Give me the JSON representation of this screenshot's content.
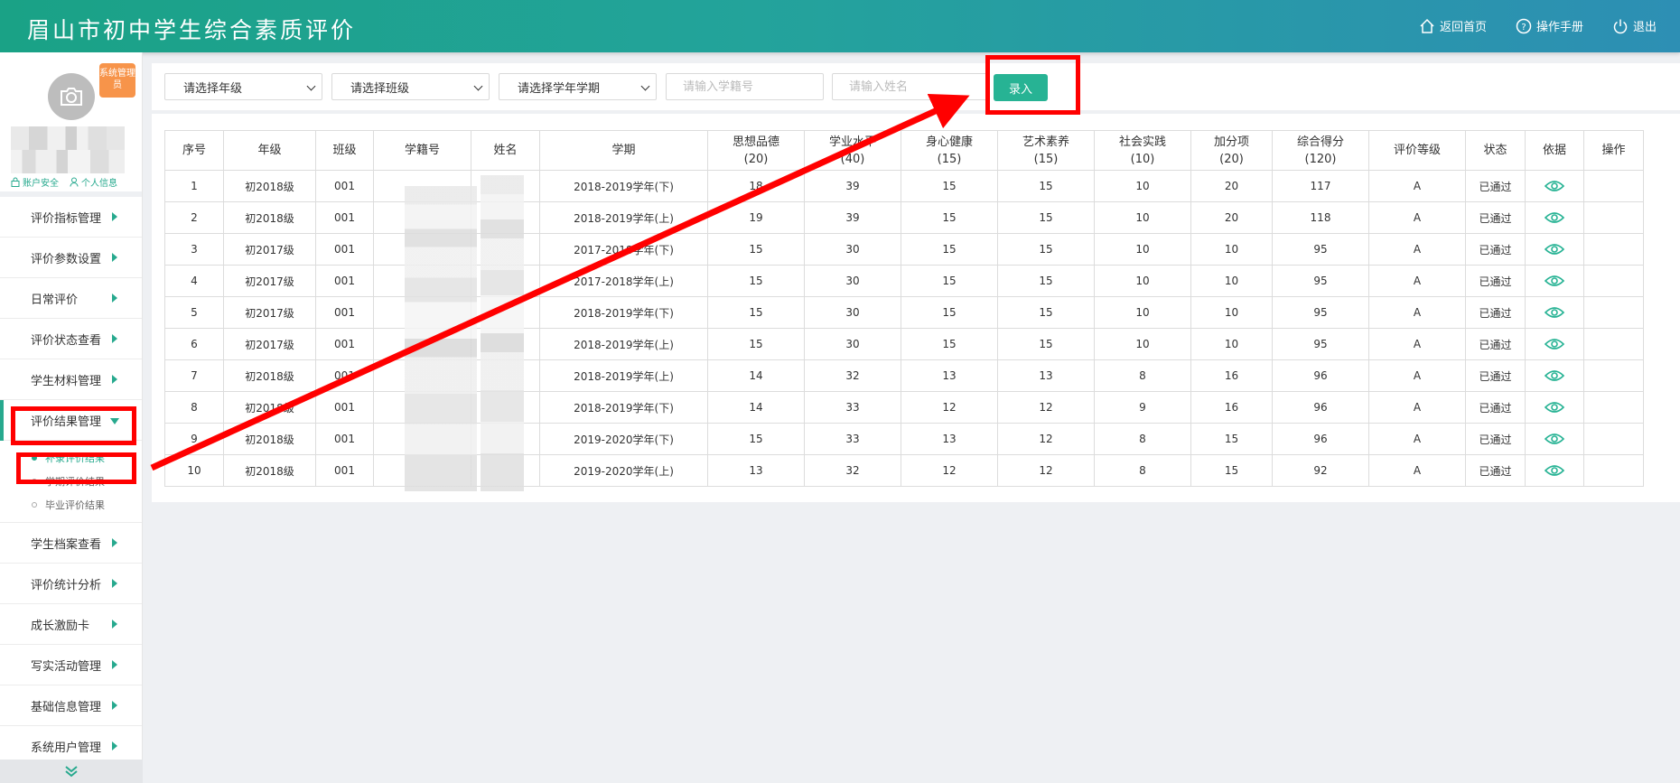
{
  "header": {
    "title": "眉山市初中学生综合素质评价",
    "links": [
      {
        "label": "返回首页",
        "icon": "home-icon"
      },
      {
        "label": "操作手册",
        "icon": "help-icon"
      },
      {
        "label": "退出",
        "icon": "power-icon"
      }
    ]
  },
  "profile": {
    "role_badge": "系统管理员",
    "account_security": "账户安全",
    "personal_info": "个人信息"
  },
  "sidebar": {
    "items": [
      {
        "label": "评价指标管理"
      },
      {
        "label": "评价参数设置"
      },
      {
        "label": "日常评价"
      },
      {
        "label": "评价状态查看"
      },
      {
        "label": "学生材料管理"
      },
      {
        "label": "评价结果管理"
      },
      {
        "label": "学生档案查看"
      },
      {
        "label": "评价统计分析"
      },
      {
        "label": "成长激励卡"
      },
      {
        "label": "写实活动管理"
      },
      {
        "label": "基础信息管理"
      },
      {
        "label": "系统用户管理"
      }
    ],
    "subitems": [
      {
        "label": "补录评价结果"
      },
      {
        "label": "学期评价结果"
      },
      {
        "label": "毕业评价结果"
      }
    ]
  },
  "filters": {
    "grade": "请选择年级",
    "class": "请选择班级",
    "term": "请选择学年学期",
    "student_id_placeholder": "请输入学籍号",
    "name_placeholder": "请输入姓名",
    "enter_button": "录入"
  },
  "table": {
    "headers": [
      {
        "l1": "序号",
        "l2": ""
      },
      {
        "l1": "年级",
        "l2": ""
      },
      {
        "l1": "班级",
        "l2": ""
      },
      {
        "l1": "学籍号",
        "l2": ""
      },
      {
        "l1": "姓名",
        "l2": ""
      },
      {
        "l1": "学期",
        "l2": ""
      },
      {
        "l1": "思想品德",
        "l2": "(20)"
      },
      {
        "l1": "学业水平",
        "l2": "(40)"
      },
      {
        "l1": "身心健康",
        "l2": "(15)"
      },
      {
        "l1": "艺术素养",
        "l2": "(15)"
      },
      {
        "l1": "社会实践",
        "l2": "(10)"
      },
      {
        "l1": "加分项",
        "l2": "(20)"
      },
      {
        "l1": "综合得分",
        "l2": "(120)"
      },
      {
        "l1": "评价等级",
        "l2": ""
      },
      {
        "l1": "状态",
        "l2": ""
      },
      {
        "l1": "依据",
        "l2": ""
      },
      {
        "l1": "操作",
        "l2": ""
      }
    ],
    "rows": [
      [
        "1",
        "初2018级",
        "001",
        "",
        "",
        "2018-2019学年(下)",
        "18",
        "39",
        "15",
        "15",
        "10",
        "20",
        "117",
        "A",
        "已通过"
      ],
      [
        "2",
        "初2018级",
        "001",
        "",
        "",
        "2018-2019学年(上)",
        "19",
        "39",
        "15",
        "15",
        "10",
        "20",
        "118",
        "A",
        "已通过"
      ],
      [
        "3",
        "初2017级",
        "001",
        "",
        "",
        "2017-2018学年(下)",
        "15",
        "30",
        "15",
        "15",
        "10",
        "10",
        "95",
        "A",
        "已通过"
      ],
      [
        "4",
        "初2017级",
        "001",
        "",
        "",
        "2017-2018学年(上)",
        "15",
        "30",
        "15",
        "15",
        "10",
        "10",
        "95",
        "A",
        "已通过"
      ],
      [
        "5",
        "初2017级",
        "001",
        "",
        "",
        "2018-2019学年(下)",
        "15",
        "30",
        "15",
        "15",
        "10",
        "10",
        "95",
        "A",
        "已通过"
      ],
      [
        "6",
        "初2017级",
        "001",
        "",
        "",
        "2018-2019学年(上)",
        "15",
        "30",
        "15",
        "15",
        "10",
        "10",
        "95",
        "A",
        "已通过"
      ],
      [
        "7",
        "初2018级",
        "001",
        "",
        "",
        "2018-2019学年(上)",
        "14",
        "32",
        "13",
        "13",
        "8",
        "16",
        "96",
        "A",
        "已通过"
      ],
      [
        "8",
        "初2018级",
        "001",
        "",
        "",
        "2018-2019学年(下)",
        "14",
        "33",
        "12",
        "12",
        "9",
        "16",
        "96",
        "A",
        "已通过"
      ],
      [
        "9",
        "初2018级",
        "001",
        "",
        "",
        "2019-2020学年(下)",
        "15",
        "33",
        "13",
        "12",
        "8",
        "15",
        "96",
        "A",
        "已通过"
      ],
      [
        "10",
        "初2018级",
        "001",
        "",
        "",
        "2019-2020学年(上)",
        "13",
        "32",
        "12",
        "12",
        "8",
        "15",
        "92",
        "A",
        "已通过"
      ]
    ]
  },
  "colors": {
    "accent": "#27a98e",
    "badge": "#f7944a",
    "annotation": "#ff0000"
  }
}
